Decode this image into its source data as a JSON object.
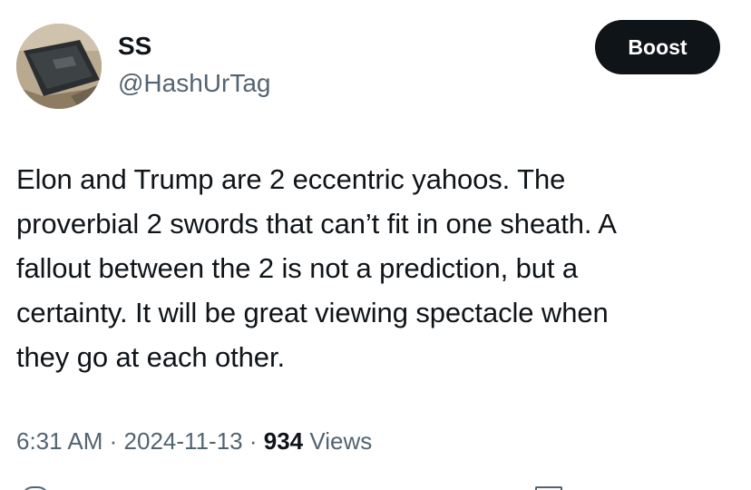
{
  "author": {
    "name": "SS",
    "handle": "@HashUrTag"
  },
  "boost_button": {
    "label": "Boost"
  },
  "tweet": {
    "lines": [
      "Elon and Trump are 2 eccentric yahoos. The",
      "proverbial 2 swords that can’t fit in one sheath. A",
      "fallout between the 2 is not a prediction, but a",
      "certainty. It will be great viewing spectacle when",
      "they go at each other."
    ]
  },
  "meta": {
    "time": "6:31 AM",
    "separator": "·",
    "date": "2024-11-13",
    "views_count": "934",
    "views_label": "Views"
  },
  "icons": {
    "avatar": "avatar-image",
    "actions": [
      "reply-icon",
      "bookmark-icon"
    ]
  }
}
